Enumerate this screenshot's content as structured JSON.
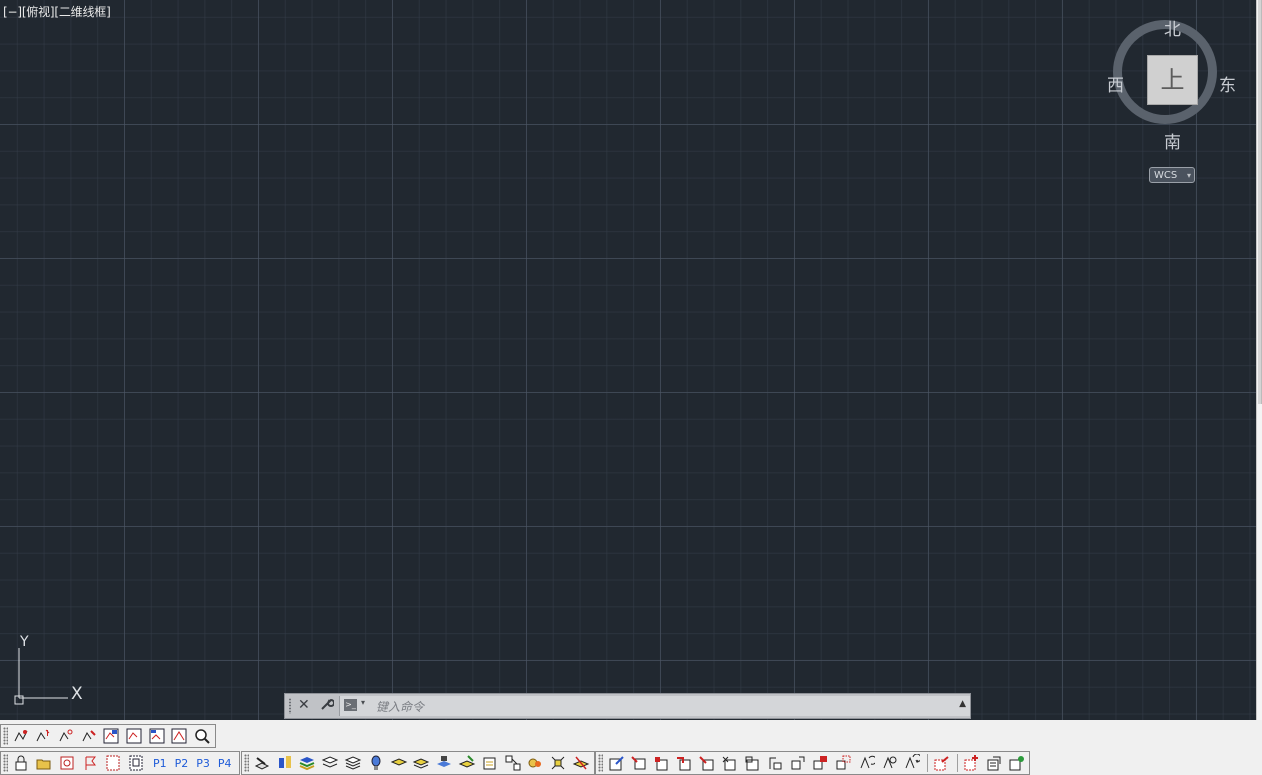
{
  "viewport": {
    "label": "[−][俯视][二维线框]"
  },
  "viewcube": {
    "north": "北",
    "south": "南",
    "west": "西",
    "east": "东",
    "face": "上",
    "ucs_menu": "WCS",
    "ucs_menu_arrow": "▾"
  },
  "ucs_icon": {
    "x_label": "X",
    "y_label": "Y"
  },
  "command_line": {
    "placeholder": "键入命令",
    "close_glyph": "✕",
    "customize_glyph": "🔧",
    "prompt_glyph": ">_",
    "history_glyph": "▲"
  },
  "toolbars": {
    "layouts": {
      "labels": [
        "P1",
        "P2",
        "P3",
        "P4"
      ]
    }
  },
  "colors": {
    "canvas_bg": "#212830",
    "accent": "#1e5bd8"
  }
}
